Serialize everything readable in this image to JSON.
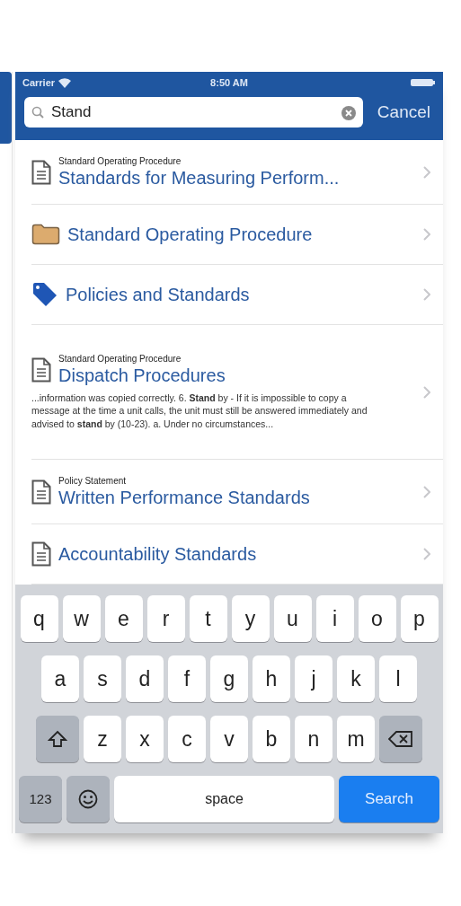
{
  "status_bar": {
    "carrier": "Carrier",
    "time": "8:50 AM"
  },
  "search": {
    "value": "Stand",
    "cancel": "Cancel"
  },
  "results": [
    {
      "kind": "document",
      "category": "Standard Operating Procedure",
      "title": "Standards for Measuring Perform..."
    },
    {
      "kind": "folder",
      "title": "Standard Operating Procedure"
    },
    {
      "kind": "tag",
      "title": "Policies and Standards"
    },
    {
      "kind": "document",
      "category": "Standard Operating Procedure",
      "title": "Dispatch Procedures",
      "snippet": "...information was copied correctly. 6. **Stand** by - If it is impossible to copy a message at the time a unit calls, the unit must still be answered immediately and advised to **stand** by (10-23). a. Under no circumstances..."
    },
    {
      "kind": "document",
      "category": "Policy Statement",
      "title": "Written Performance Standards"
    },
    {
      "kind": "document",
      "title": "Accountability Standards"
    }
  ],
  "keyboard": {
    "rows": [
      {
        "keys": [
          {
            "kind": "letter",
            "label": "q"
          },
          {
            "kind": "letter",
            "label": "w"
          },
          {
            "kind": "letter",
            "label": "e"
          },
          {
            "kind": "letter",
            "label": "r"
          },
          {
            "kind": "letter",
            "label": "t"
          },
          {
            "kind": "letter",
            "label": "y"
          },
          {
            "kind": "letter",
            "label": "u"
          },
          {
            "kind": "letter",
            "label": "i"
          },
          {
            "kind": "letter",
            "label": "o"
          },
          {
            "kind": "letter",
            "label": "p"
          }
        ]
      },
      {
        "keys": [
          {
            "kind": "letter",
            "label": "a"
          },
          {
            "kind": "letter",
            "label": "s"
          },
          {
            "kind": "letter",
            "label": "d"
          },
          {
            "kind": "letter",
            "label": "f"
          },
          {
            "kind": "letter",
            "label": "g"
          },
          {
            "kind": "letter",
            "label": "h"
          },
          {
            "kind": "letter",
            "label": "j"
          },
          {
            "kind": "letter",
            "label": "k"
          },
          {
            "kind": "letter",
            "label": "l"
          }
        ]
      },
      {
        "keys": [
          {
            "kind": "shift"
          },
          {
            "kind": "letter",
            "label": "z"
          },
          {
            "kind": "letter",
            "label": "x"
          },
          {
            "kind": "letter",
            "label": "c"
          },
          {
            "kind": "letter",
            "label": "v"
          },
          {
            "kind": "letter",
            "label": "b"
          },
          {
            "kind": "letter",
            "label": "n"
          },
          {
            "kind": "letter",
            "label": "m"
          },
          {
            "kind": "delete"
          }
        ]
      },
      {
        "keys": [
          {
            "kind": "numbers",
            "label": "123"
          },
          {
            "kind": "emoji"
          },
          {
            "kind": "space",
            "label": "space"
          },
          {
            "kind": "search",
            "label": "Search"
          }
        ]
      }
    ]
  }
}
